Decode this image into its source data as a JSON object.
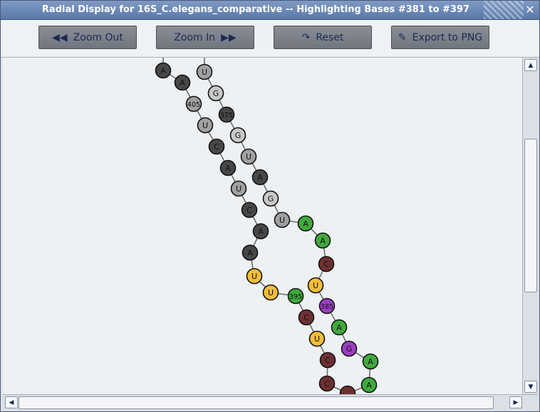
{
  "window": {
    "title": "Radial Display for 16S_C.elegans_comparative -- Highlighting Bases #381 to #397"
  },
  "toolbar": {
    "zoom_out": {
      "label": "Zoom Out",
      "icon": "double-left-arrow-icon"
    },
    "zoom_in": {
      "label": "Zoom In",
      "icon": "double-right-arrow-icon"
    },
    "reset": {
      "label": "Reset",
      "icon": "redo-arrow-icon"
    },
    "export": {
      "label": "Export to PNG",
      "icon": "export-edit-icon"
    }
  },
  "colors": {
    "dark": "#474747",
    "gray": "#a0a0a0",
    "light": "#c8c8c8",
    "green": "#3faa3c",
    "yellow": "#f2bd3a",
    "maroon": "#6e3030",
    "purple": "#9a3fc2"
  },
  "bases": [
    {
      "label": "A",
      "color": "dark"
    },
    {
      "label": "A",
      "color": "dark"
    },
    {
      "label": "405",
      "color": "gray"
    },
    {
      "label": "U",
      "color": "gray"
    },
    {
      "label": "C",
      "color": "dark"
    },
    {
      "label": "A",
      "color": "dark"
    },
    {
      "label": "U",
      "color": "gray"
    },
    {
      "label": "C",
      "color": "dark"
    },
    {
      "label": "A",
      "color": "dark"
    },
    {
      "label": "A",
      "color": "dark"
    },
    {
      "label": "U",
      "color": "yellow"
    },
    {
      "label": "U",
      "color": "yellow"
    },
    {
      "label": "395",
      "color": "green"
    },
    {
      "label": "C",
      "color": "maroon"
    },
    {
      "label": "U",
      "color": "yellow"
    },
    {
      "label": "C",
      "color": "maroon"
    },
    {
      "label": "C",
      "color": "maroon"
    },
    {
      "label": "",
      "color": "maroon"
    },
    {
      "label": "A",
      "color": "green"
    },
    {
      "label": "A",
      "color": "green"
    },
    {
      "label": "G",
      "color": "purple"
    },
    {
      "label": "A",
      "color": "green"
    },
    {
      "label": "385",
      "color": "purple"
    },
    {
      "label": "U",
      "color": "yellow"
    },
    {
      "label": "C",
      "color": "maroon"
    },
    {
      "label": "A",
      "color": "green"
    },
    {
      "label": "A",
      "color": "green"
    },
    {
      "label": "U",
      "color": "gray"
    },
    {
      "label": "G",
      "color": "light"
    },
    {
      "label": "A",
      "color": "dark"
    },
    {
      "label": "U",
      "color": "gray"
    },
    {
      "label": "G",
      "color": "light"
    },
    {
      "label": "375",
      "color": "dark"
    },
    {
      "label": "G",
      "color": "light"
    },
    {
      "label": "U",
      "color": "gray"
    }
  ]
}
